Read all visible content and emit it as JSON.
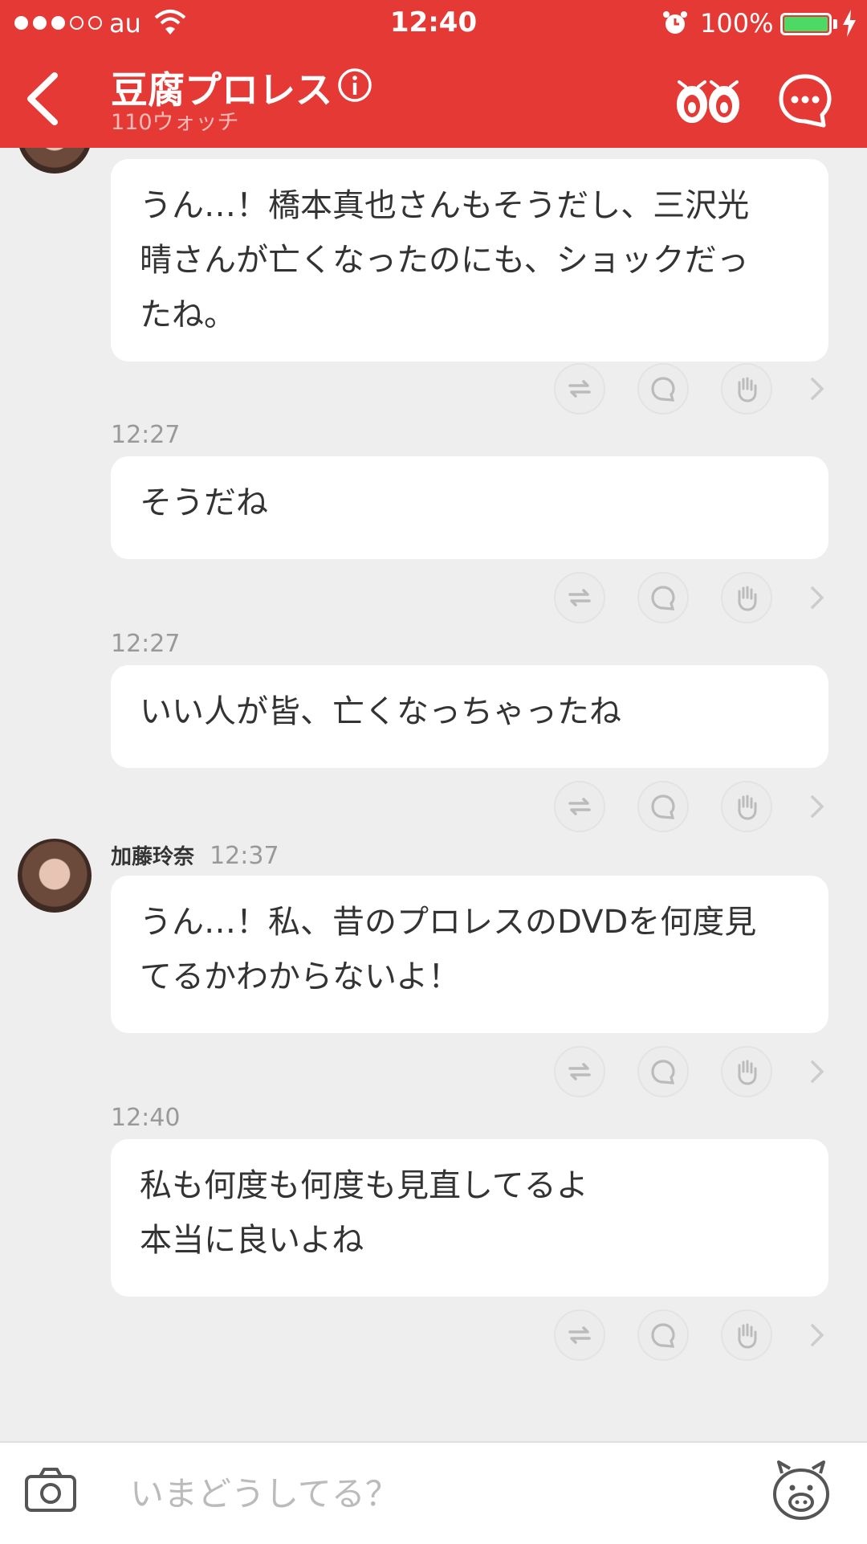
{
  "status_bar": {
    "carrier": "au",
    "time": "12:40",
    "battery": "100%"
  },
  "header": {
    "title": "豆腐プロレス",
    "subtitle": "110ウォッチ"
  },
  "messages": [
    {
      "text": "うん…！橋本真也さんもそうだし、三沢光\n晴さんが亡くなったのにも、ショックだっ\nたね。"
    },
    {
      "time": "12:27",
      "text": "そうだね"
    },
    {
      "time": "12:27",
      "text": "いい人が皆、亡くなっちゃったね"
    },
    {
      "sender": "加藤玲奈",
      "time": "12:37",
      "text": "うん…！私、昔のプロレスのDVDを何度見\nてるかわからないよ！"
    },
    {
      "time": "12:40",
      "text": "私も何度も何度も見直してるよ\n本当に良いよね"
    }
  ],
  "input": {
    "placeholder": "いまどうしてる？"
  },
  "icons": {
    "back": "chevron-left-icon",
    "info": "info-icon",
    "watch": "eyes-icon",
    "chat": "chat-bubble-icon",
    "repost": "repost-icon",
    "comment": "comment-icon",
    "clap": "hand-icon",
    "more": "chevron-right-icon",
    "camera": "camera-icon",
    "stamp": "pig-stamp-icon"
  },
  "colors": {
    "header_bg": "#e53935",
    "background": "#eeeeee",
    "battery": "#4cd964"
  }
}
